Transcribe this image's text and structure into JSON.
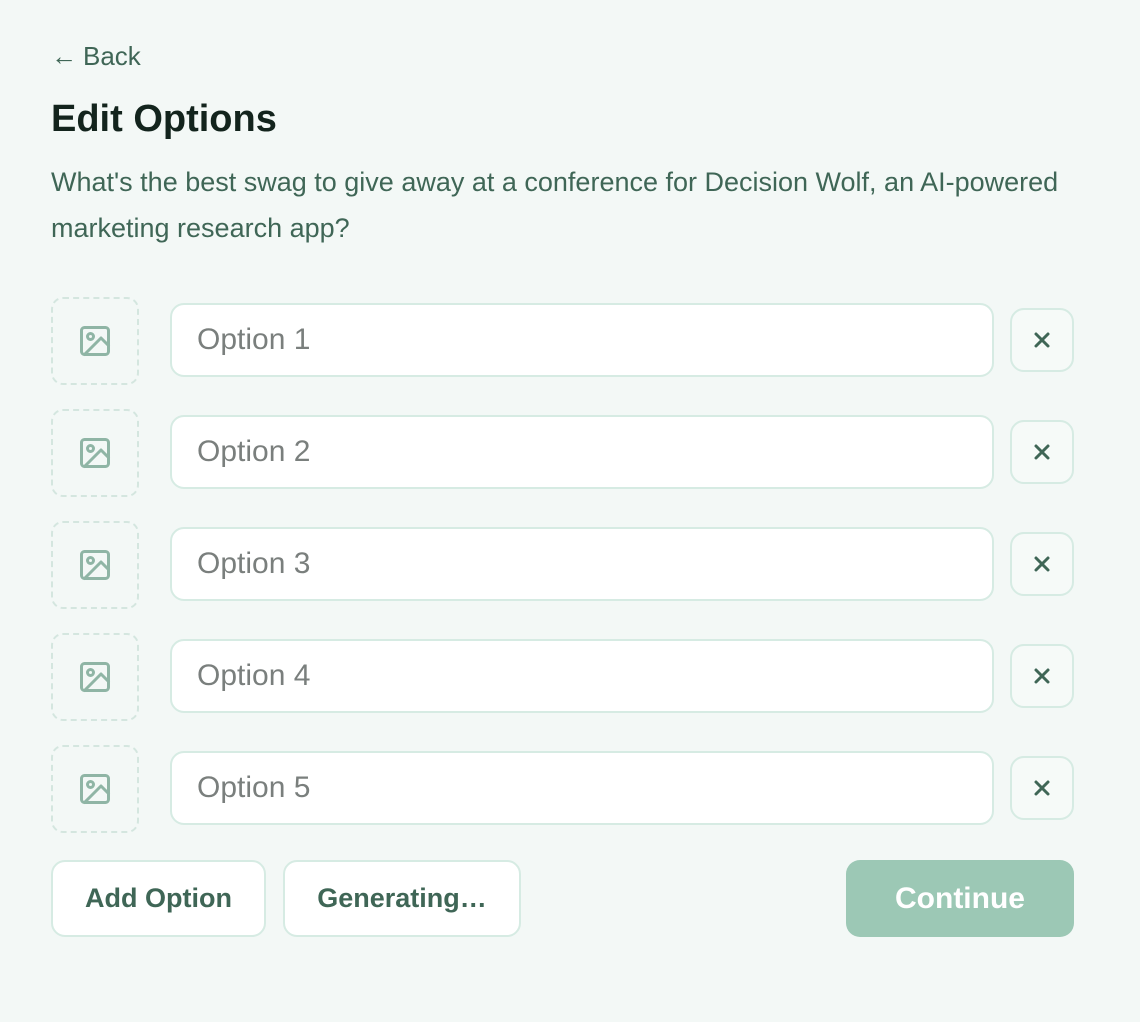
{
  "nav": {
    "back_label": "Back",
    "back_arrow": "←"
  },
  "header": {
    "title": "Edit Options"
  },
  "question": "What's the best swag to give away at a conference for Decision Wolf, an AI-powered marketing research app?",
  "options": [
    {
      "placeholder": "Option 1",
      "value": ""
    },
    {
      "placeholder": "Option 2",
      "value": ""
    },
    {
      "placeholder": "Option 3",
      "value": ""
    },
    {
      "placeholder": "Option 4",
      "value": ""
    },
    {
      "placeholder": "Option 5",
      "value": ""
    }
  ],
  "icons": {
    "image_slot": "image-icon",
    "remove": "close-icon"
  },
  "actions": {
    "add_label": "Add Option",
    "generate_label": "Generating…",
    "continue_label": "Continue"
  },
  "colors": {
    "background": "#f3f8f6",
    "accent": "#3f6656",
    "continue_disabled": "#9cc8b5",
    "border": "#d6ebe3"
  }
}
